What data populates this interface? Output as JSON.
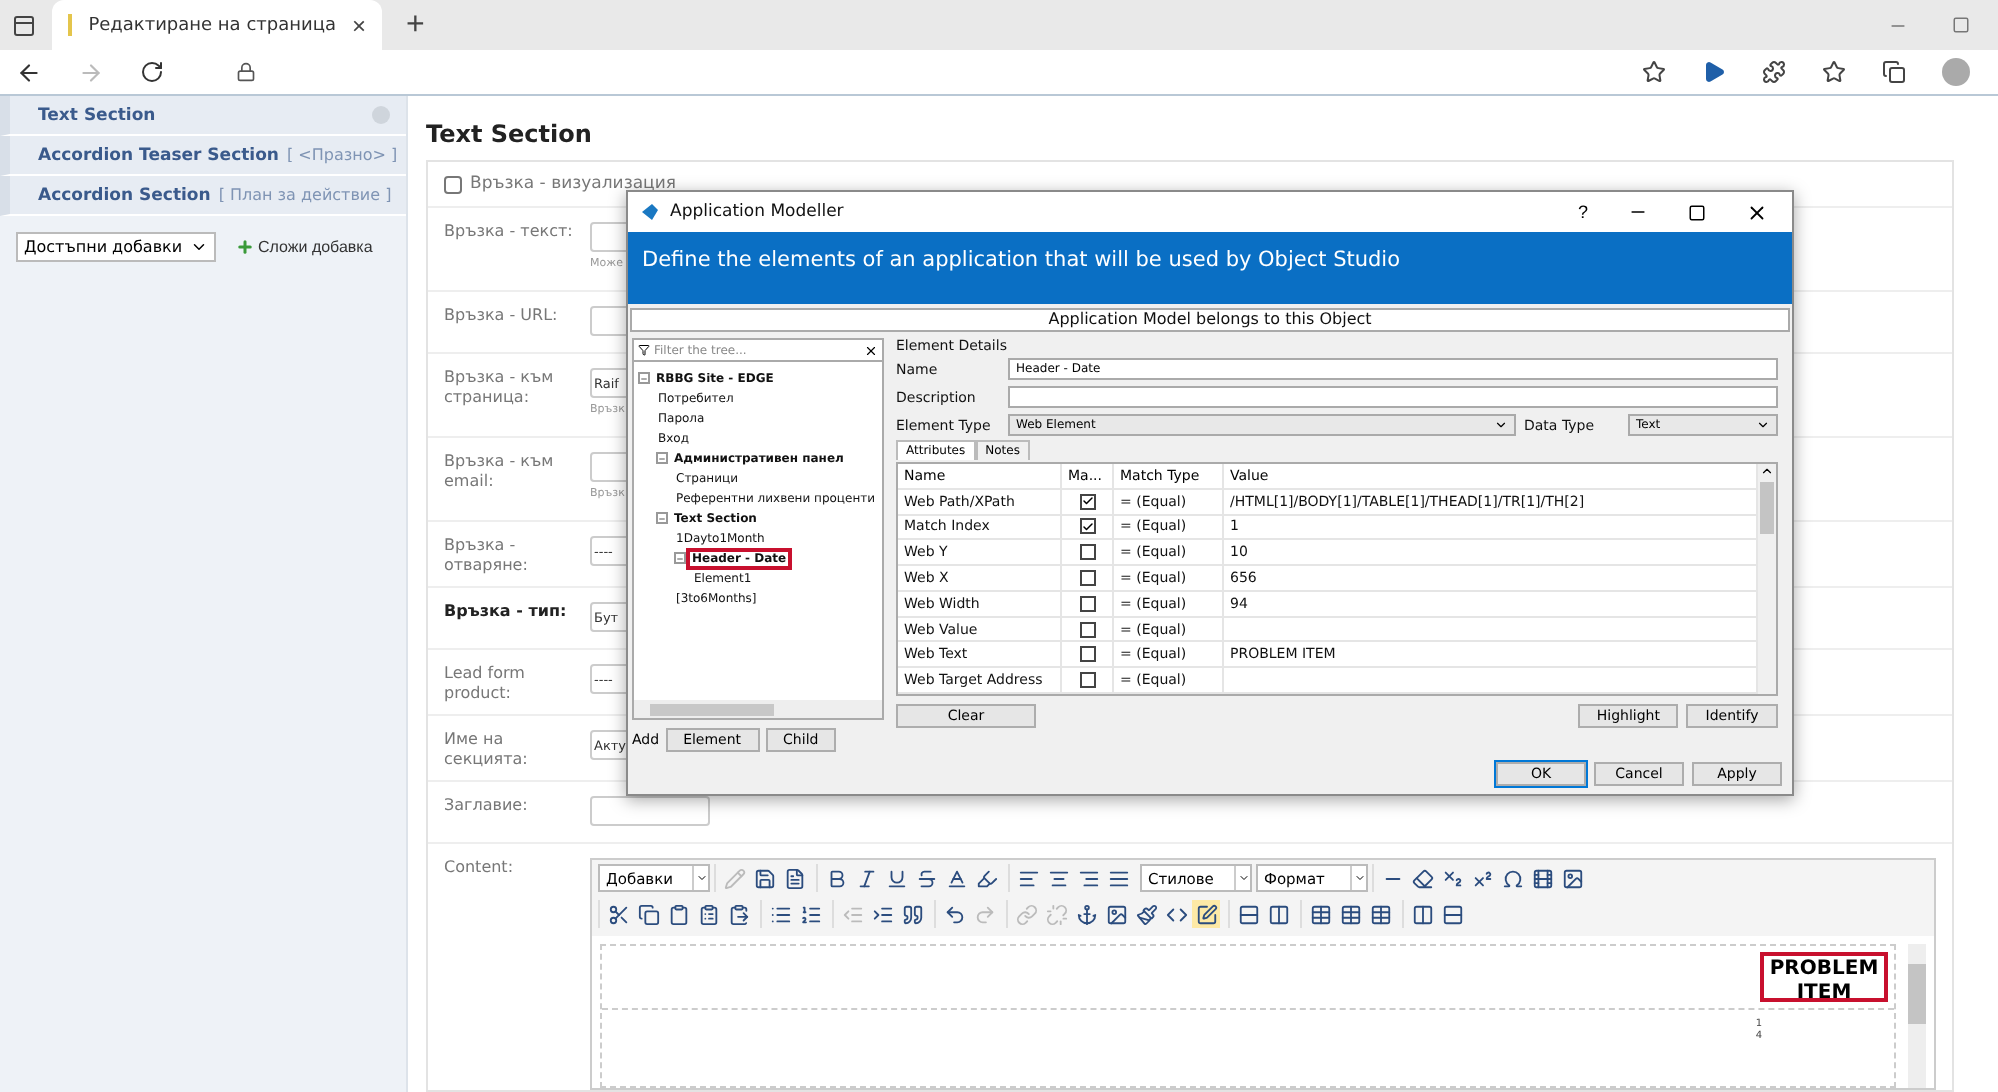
{
  "browser": {
    "tab_title": "Редактиране на страница",
    "tab_close": "×",
    "new_tab": "+"
  },
  "sidebar": {
    "items": [
      {
        "title": "Text Section"
      },
      {
        "title": "Accordion Teaser Section",
        "note": "[ <Празно> ]"
      },
      {
        "title": "Accordion Section",
        "note": "[ План за действие ]"
      }
    ],
    "addon_select": "Достъпни добавки",
    "add_button": "Сложи добавка"
  },
  "page": {
    "heading": "Text Section",
    "visualization": {
      "label": "Връзка - визуализация",
      "checked": false
    },
    "fields": [
      {
        "label": "Връзка - текст:",
        "hint": "Може"
      },
      {
        "label": "Връзка - URL:"
      },
      {
        "label": "Връзка - към страница:",
        "value": "Raif",
        "hint": "Връзк"
      },
      {
        "label": "Връзка - към email:",
        "hint": "Връзк"
      },
      {
        "label": "Връзка - отваряне:",
        "value": "----"
      },
      {
        "label": "Връзка - тип:",
        "value": "Бут",
        "emphasis": true
      },
      {
        "label": "Lead form product:",
        "value": "----"
      },
      {
        "label": "Име на секцията:",
        "value": "Акту"
      },
      {
        "label": "Заглавие:"
      }
    ],
    "content_label": "Content:"
  },
  "editor": {
    "dropdowns": [
      "Добавки",
      "Стилове",
      "Формат"
    ],
    "cell_text": "PROBLEM ITEM",
    "cell_marks": [
      "1",
      "4"
    ]
  },
  "dialog": {
    "title": "Application Modeller",
    "help": "?",
    "banner": "Define the elements of an application that will be used by Object Studio",
    "model_bar": "Application Model belongs to this Object",
    "filter_placeholder": "Filter the tree...",
    "tree": [
      {
        "label": "RBBG Site - EDGE",
        "bold": true,
        "expanded": true,
        "children": [
          {
            "label": "Потребител"
          },
          {
            "label": "Парола"
          },
          {
            "label": "Вход"
          },
          {
            "label": "Административен панел",
            "bold": true,
            "expanded": true,
            "children": [
              {
                "label": "Страници"
              },
              {
                "label": "Референтни лихвени проценти"
              }
            ]
          },
          {
            "label": "Text Section",
            "bold": true,
            "expanded": true,
            "children": [
              {
                "label": "1Dayto1Month"
              },
              {
                "label": "Header - Date",
                "bold": true,
                "expanded": true,
                "selected": true,
                "children": [
                  {
                    "label": "Element1"
                  }
                ]
              },
              {
                "label": "[3to6Months]"
              }
            ]
          }
        ]
      }
    ],
    "add_label": "Add",
    "add_buttons": [
      "Element",
      "Child"
    ],
    "details_title": "Element Details",
    "name_label": "Name",
    "name_value": "Header - Date",
    "description_label": "Description",
    "element_type_label": "Element Type",
    "element_type": "Web Element",
    "data_type_label": "Data Type",
    "data_type": "Text",
    "tabs": [
      {
        "label": "Attributes",
        "selected": true
      },
      {
        "label": "Notes",
        "selected": false
      }
    ],
    "columns": [
      "Name",
      "Ma...",
      "Match Type",
      "Value"
    ],
    "rows": [
      {
        "name": "Web Path/XPath",
        "checked": true,
        "match": "= (Equal)",
        "value": "/HTML[1]/BODY[1]/TABLE[1]/THEAD[1]/TR[1]/TH[2]"
      },
      {
        "name": "Match Index",
        "checked": true,
        "match": "= (Equal)",
        "value": "1"
      },
      {
        "name": "Web Y",
        "checked": false,
        "match": "= (Equal)",
        "value": "10"
      },
      {
        "name": "Web X",
        "checked": false,
        "match": "= (Equal)",
        "value": "656"
      },
      {
        "name": "Web Width",
        "checked": false,
        "match": "= (Equal)",
        "value": "94"
      },
      {
        "name": "Web Value",
        "checked": false,
        "match": "= (Equal)"
      },
      {
        "name": "Web Text",
        "checked": false,
        "match": "= (Equal)",
        "value": "PROBLEM ITEM"
      },
      {
        "name": "Web Target Address",
        "checked": false,
        "match": "= (Equal)"
      }
    ],
    "clear_button": "Clear",
    "highlight_button": "Highlight",
    "identify_button": "Identify",
    "footer_buttons": [
      "OK",
      "Cancel",
      "Apply"
    ]
  }
}
